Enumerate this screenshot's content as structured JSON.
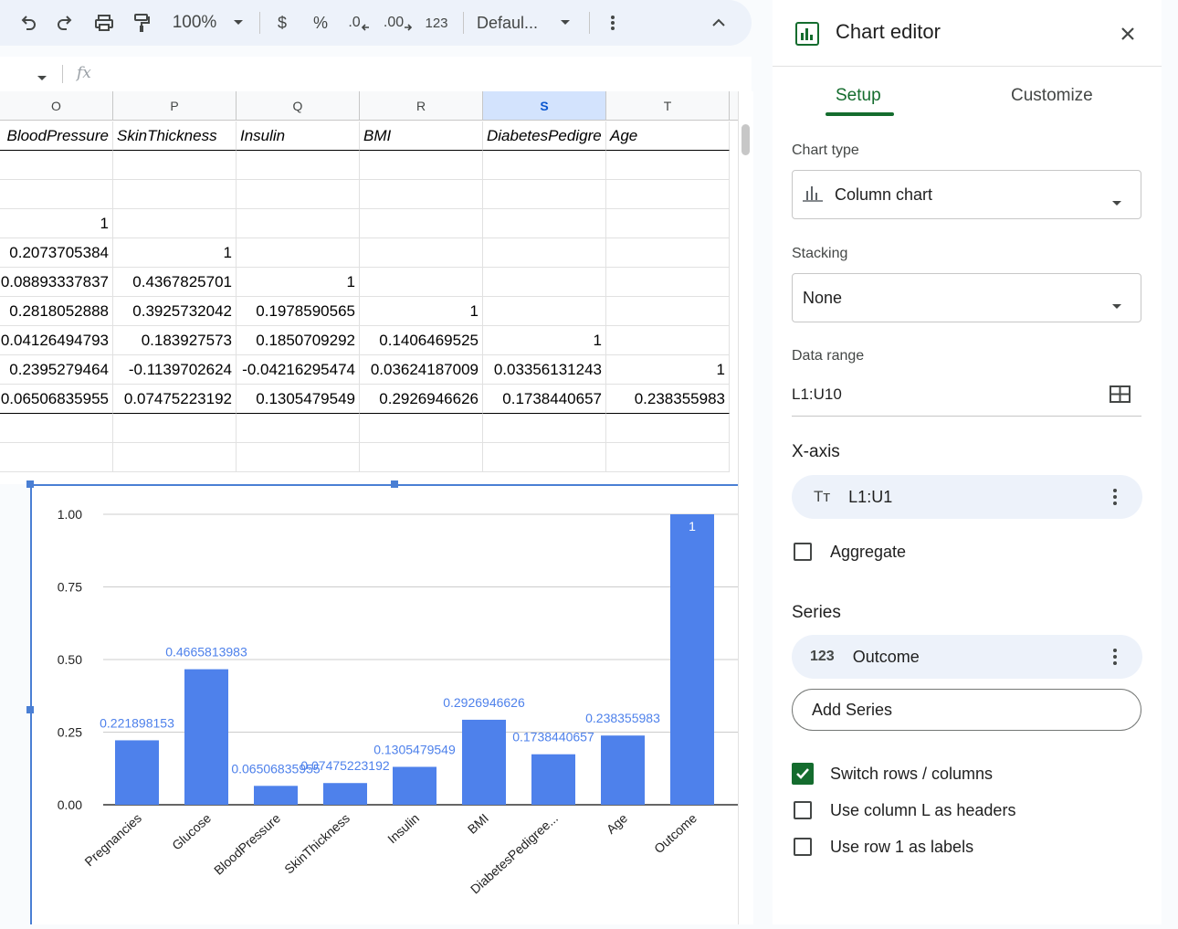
{
  "toolbar": {
    "zoom": "100%",
    "currency": "$",
    "percent": "%",
    "dec_decrease": ".0",
    "dec_increase": ".00",
    "number_format": "123",
    "font": "Defaul..."
  },
  "formula_bar": {
    "fx": "fx"
  },
  "sheet": {
    "columns": [
      "O",
      "P",
      "Q",
      "R",
      "S",
      "T"
    ],
    "selected_column": "S",
    "header_row": [
      "BloodPressure",
      "SkinThickness",
      "Insulin",
      "BMI",
      "DiabetesPedigre",
      "Age"
    ],
    "rows": [
      [
        "",
        "",
        "",
        "",
        "",
        ""
      ],
      [
        "",
        "",
        "",
        "",
        "",
        ""
      ],
      [
        "1",
        "",
        "",
        "",
        "",
        ""
      ],
      [
        "0.2073705384",
        "1",
        "",
        "",
        "",
        ""
      ],
      [
        "0.08893337837",
        "0.4367825701",
        "1",
        "",
        "",
        ""
      ],
      [
        "0.2818052888",
        "0.3925732042",
        "0.1978590565",
        "1",
        "",
        ""
      ],
      [
        "0.04126494793",
        "0.183927573",
        "0.1850709292",
        "0.1406469525",
        "1",
        ""
      ],
      [
        "0.2395279464",
        "-0.1139702624",
        "-0.04216295474",
        "0.03624187009",
        "0.03356131243",
        "1"
      ],
      [
        "0.06506835955",
        "0.07475223192",
        "0.1305479549",
        "0.2926946626",
        "0.1738440657",
        "0.238355983"
      ],
      [
        "",
        "",
        "",
        "",
        "",
        ""
      ],
      [
        "",
        "",
        "",
        "",
        "",
        ""
      ]
    ]
  },
  "chart_data": {
    "type": "bar",
    "categories": [
      "Pregnancies",
      "Glucose",
      "BloodPressure",
      "SkinThickness",
      "Insulin",
      "BMI",
      "DiabetesPedigree...",
      "Age",
      "Outcome"
    ],
    "values": [
      0.221898153,
      0.4665813983,
      0.06506835955,
      0.07475223192,
      0.1305479549,
      0.2926946626,
      0.1738440657,
      0.238355983,
      1
    ],
    "value_labels": [
      "0.221898153",
      "0.4665813983",
      "0.06506835955",
      "0.07475223192",
      "0.1305479549",
      "0.2926946626",
      "0.1738440657",
      "0.238355983",
      "1"
    ],
    "yticks": [
      "0.00",
      "0.25",
      "0.50",
      "0.75",
      "1.00"
    ],
    "ylim": [
      0,
      1
    ],
    "bar_color": "#4e81eb",
    "label_color": "#4e81eb",
    "grid": true
  },
  "panel": {
    "title": "Chart editor",
    "tabs": [
      "Setup",
      "Customize"
    ],
    "active_tab": "Setup",
    "chart_type_label": "Chart type",
    "chart_type_value": "Column chart",
    "stacking_label": "Stacking",
    "stacking_value": "None",
    "data_range_label": "Data range",
    "data_range_value": "L1:U10",
    "xaxis_label": "X-axis",
    "xaxis_value": "L1:U1",
    "xaxis_icon_text": "Tт",
    "aggregate_label": "Aggregate",
    "series_label": "Series",
    "series_value": "Outcome",
    "series_icon_text": "123",
    "add_series": "Add Series",
    "options": [
      {
        "label": "Switch rows / columns",
        "checked": true
      },
      {
        "label": "Use column L as headers",
        "checked": false
      },
      {
        "label": "Use row 1 as labels",
        "checked": false
      }
    ],
    "accent": "#146c2e"
  }
}
